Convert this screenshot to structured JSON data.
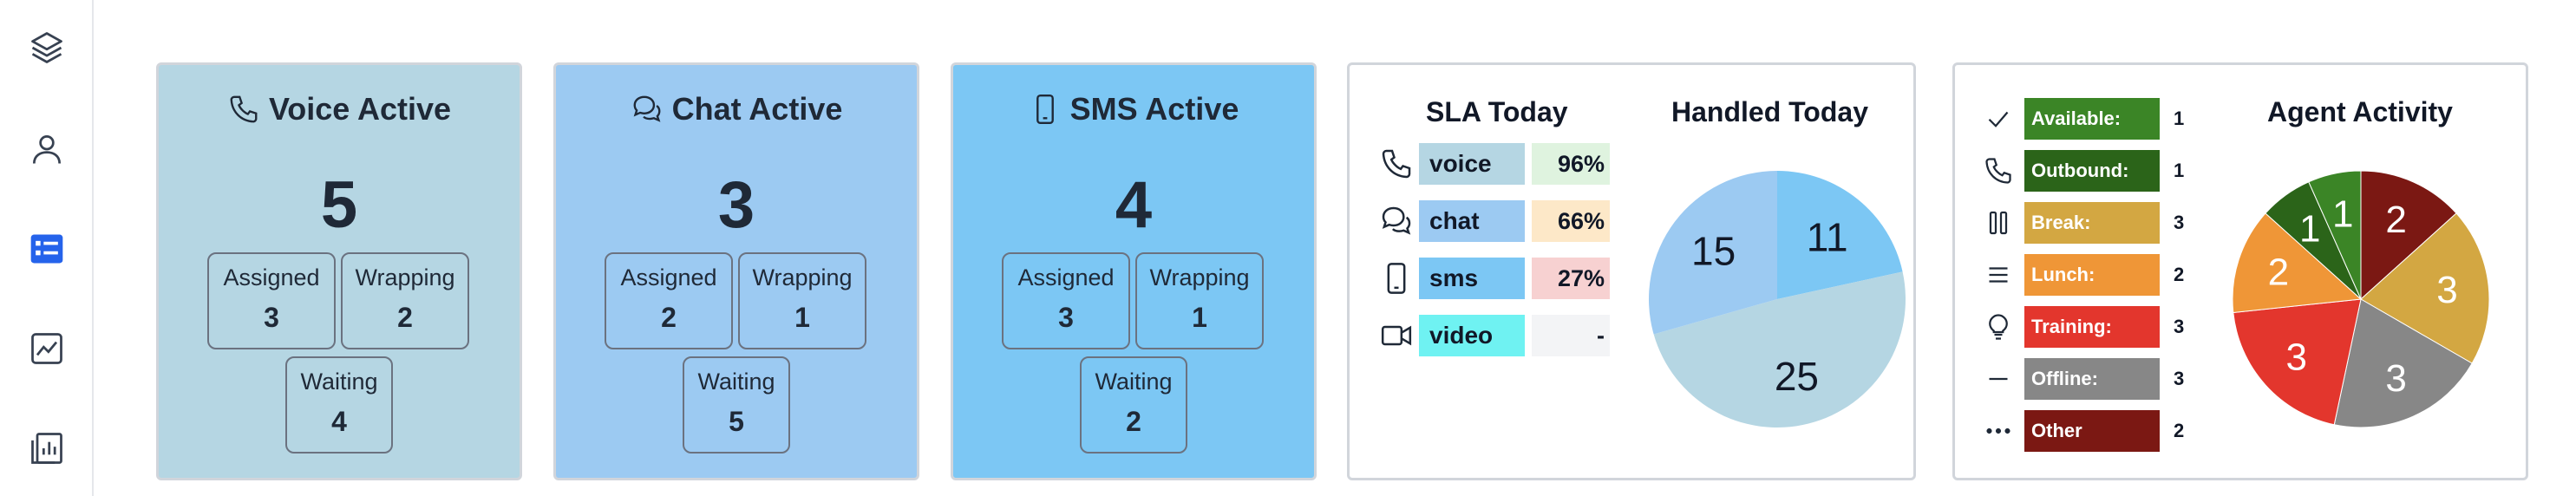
{
  "sidebar": {
    "items": [
      {
        "icon": "layers-icon",
        "active": false
      },
      {
        "icon": "user-icon",
        "active": false
      },
      {
        "icon": "list-card-icon",
        "active": true
      },
      {
        "icon": "trend-chart-icon",
        "active": false
      },
      {
        "icon": "report-icon",
        "active": false
      }
    ]
  },
  "channels": [
    {
      "title": "Voice Active",
      "icon": "phone-icon",
      "bg": "#b5d6e3",
      "total": "5",
      "assigned_label": "Assigned",
      "assigned": "3",
      "wrapping_label": "Wrapping",
      "wrapping": "2",
      "waiting_label": "Waiting",
      "waiting": "4"
    },
    {
      "title": "Chat Active",
      "icon": "chat-icon",
      "bg": "#9ccaf2",
      "total": "3",
      "assigned_label": "Assigned",
      "assigned": "2",
      "wrapping_label": "Wrapping",
      "wrapping": "1",
      "waiting_label": "Waiting",
      "waiting": "5"
    },
    {
      "title": "SMS Active",
      "icon": "mobile-icon",
      "bg": "#7cc7f4",
      "total": "4",
      "assigned_label": "Assigned",
      "assigned": "3",
      "wrapping_label": "Wrapping",
      "wrapping": "1",
      "waiting_label": "Waiting",
      "waiting": "2"
    }
  ],
  "sla": {
    "title": "SLA Today",
    "rows": [
      {
        "name": "voice",
        "icon": "phone-icon",
        "name_bg": "#b5d6e3",
        "pct": "96%",
        "pct_bg": "#dff3df"
      },
      {
        "name": "chat",
        "icon": "chat-icon",
        "name_bg": "#9ccaf2",
        "pct": "66%",
        "pct_bg": "#fde8c8"
      },
      {
        "name": "sms",
        "icon": "mobile-icon",
        "name_bg": "#7cc7f4",
        "pct": "27%",
        "pct_bg": "#f7d1d1"
      },
      {
        "name": "video",
        "icon": "video-icon",
        "name_bg": "#6ff2f2",
        "pct": "-",
        "pct_bg": "#f3f4f6"
      }
    ]
  },
  "handled": {
    "title": "Handled Today",
    "chart_data": {
      "type": "pie",
      "categories": [
        "sms",
        "voice",
        "chat"
      ],
      "values": [
        11,
        25,
        15
      ],
      "colors": [
        "#7cc7f4",
        "#b5d6e3",
        "#9ccaf2"
      ]
    }
  },
  "activity": {
    "title": "Agent Activity",
    "rows": [
      {
        "label": "Available:",
        "count": "1",
        "color": "#3b8526",
        "icon": "check-icon"
      },
      {
        "label": "Outbound:",
        "count": "1",
        "color": "#2b6419",
        "icon": "phone-icon"
      },
      {
        "label": "Break:",
        "count": "3",
        "color": "#d3a742",
        "icon": "pause-icon"
      },
      {
        "label": "Lunch:",
        "count": "2",
        "color": "#ef9637",
        "icon": "menu-icon"
      },
      {
        "label": "Training:",
        "count": "3",
        "color": "#e3362d",
        "icon": "lightbulb-icon"
      },
      {
        "label": "Offline:",
        "count": "3",
        "color": "#878787",
        "icon": "dash-icon"
      },
      {
        "label": "Other",
        "count": "2",
        "color": "#7b1813",
        "icon": "more-icon"
      }
    ],
    "chart_data": {
      "type": "pie",
      "categories": [
        "Other",
        "Break:",
        "Offline:",
        "Training:",
        "Lunch:",
        "Outbound:",
        "Available:"
      ],
      "values": [
        2,
        3,
        3,
        3,
        2,
        1,
        1
      ],
      "colors": [
        "#7b1813",
        "#d3a742",
        "#878787",
        "#e3362d",
        "#ef9637",
        "#2b6419",
        "#3b8526"
      ]
    }
  }
}
